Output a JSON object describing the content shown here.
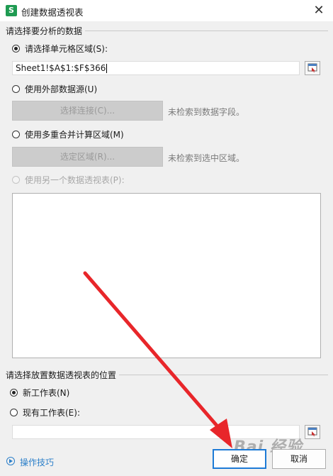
{
  "window": {
    "title": "创建数据透视表",
    "app_icon_glyph": "S",
    "close_glyph": "✕"
  },
  "source_section": {
    "label": "请选择要分析的数据",
    "option_range": {
      "label": "请选择单元格区域(S):",
      "selected": true
    },
    "range_value": "Sheet1!$A$1:$F$366",
    "option_external": {
      "label": "使用外部数据源(U)",
      "selected": false
    },
    "choose_connection_button": "选择连接(C)...",
    "external_hint": "未检索到数据字段。",
    "option_consolidate": {
      "label": "使用多重合并计算区域(M)",
      "selected": false
    },
    "choose_region_button": "选定区域(R)...",
    "consolidate_hint": "未检索到选中区域。",
    "option_other_pivot": {
      "label": "使用另一个数据透视表(P):",
      "selected": false,
      "disabled": true
    }
  },
  "placement_section": {
    "label": "请选择放置数据透视表的位置",
    "option_new_sheet": {
      "label": "新工作表(N)",
      "selected": true
    },
    "option_existing_sheet": {
      "label": "现有工作表(E):",
      "selected": false
    },
    "location_value": ""
  },
  "footer": {
    "tips_label": "操作技巧",
    "ok_button": "确定",
    "cancel_button": "取消",
    "watermark_text": "Bai 经验"
  },
  "colors": {
    "accent": "#1e7bd6",
    "tips_link": "#2b7fc9",
    "arrow": "#e8262a",
    "app_icon": "#1f9b52"
  },
  "icons": {
    "range_picker": "range-select-icon",
    "tips": "play-circle-icon",
    "annotation": "red-arrow-annotation"
  }
}
